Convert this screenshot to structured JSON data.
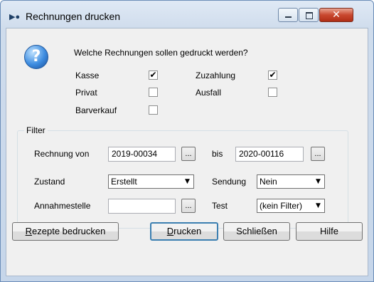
{
  "window": {
    "title": "Rechnungen drucken",
    "close_glyph": "✕"
  },
  "question": {
    "text": "Welche Rechnungen sollen gedruckt werden?",
    "help_icon": "help-question-icon",
    "help_glyph": "?"
  },
  "types": {
    "kasse": {
      "label": "Kasse",
      "checked": true,
      "mark": "✔"
    },
    "zuzahlung": {
      "label": "Zuzahlung",
      "checked": true,
      "mark": "✔"
    },
    "privat": {
      "label": "Privat",
      "checked": false
    },
    "ausfall": {
      "label": "Ausfall",
      "checked": false
    },
    "barverkauf": {
      "label": "Barverkauf",
      "checked": false
    }
  },
  "filter": {
    "group_label": "Filter",
    "rechnung_von": {
      "label": "Rechnung von",
      "value": "2019-00034"
    },
    "bis": {
      "label": "bis",
      "value": "2020-00116"
    },
    "zustand": {
      "label": "Zustand",
      "value": "Erstellt"
    },
    "sendung": {
      "label": "Sendung",
      "value": "Nein"
    },
    "annahmestelle": {
      "label": "Annahmestelle",
      "value": ""
    },
    "test": {
      "label": "Test",
      "value": "(kein Filter)"
    },
    "browse_label": "...",
    "dropdown_arrow": "▼"
  },
  "buttons": {
    "rezepte": {
      "mnemonic": "R",
      "rest": "ezepte bedrucken"
    },
    "drucken": {
      "mnemonic": "D",
      "rest": "rucken"
    },
    "schliessen": "Schließen",
    "hilfe": "Hilfe"
  }
}
